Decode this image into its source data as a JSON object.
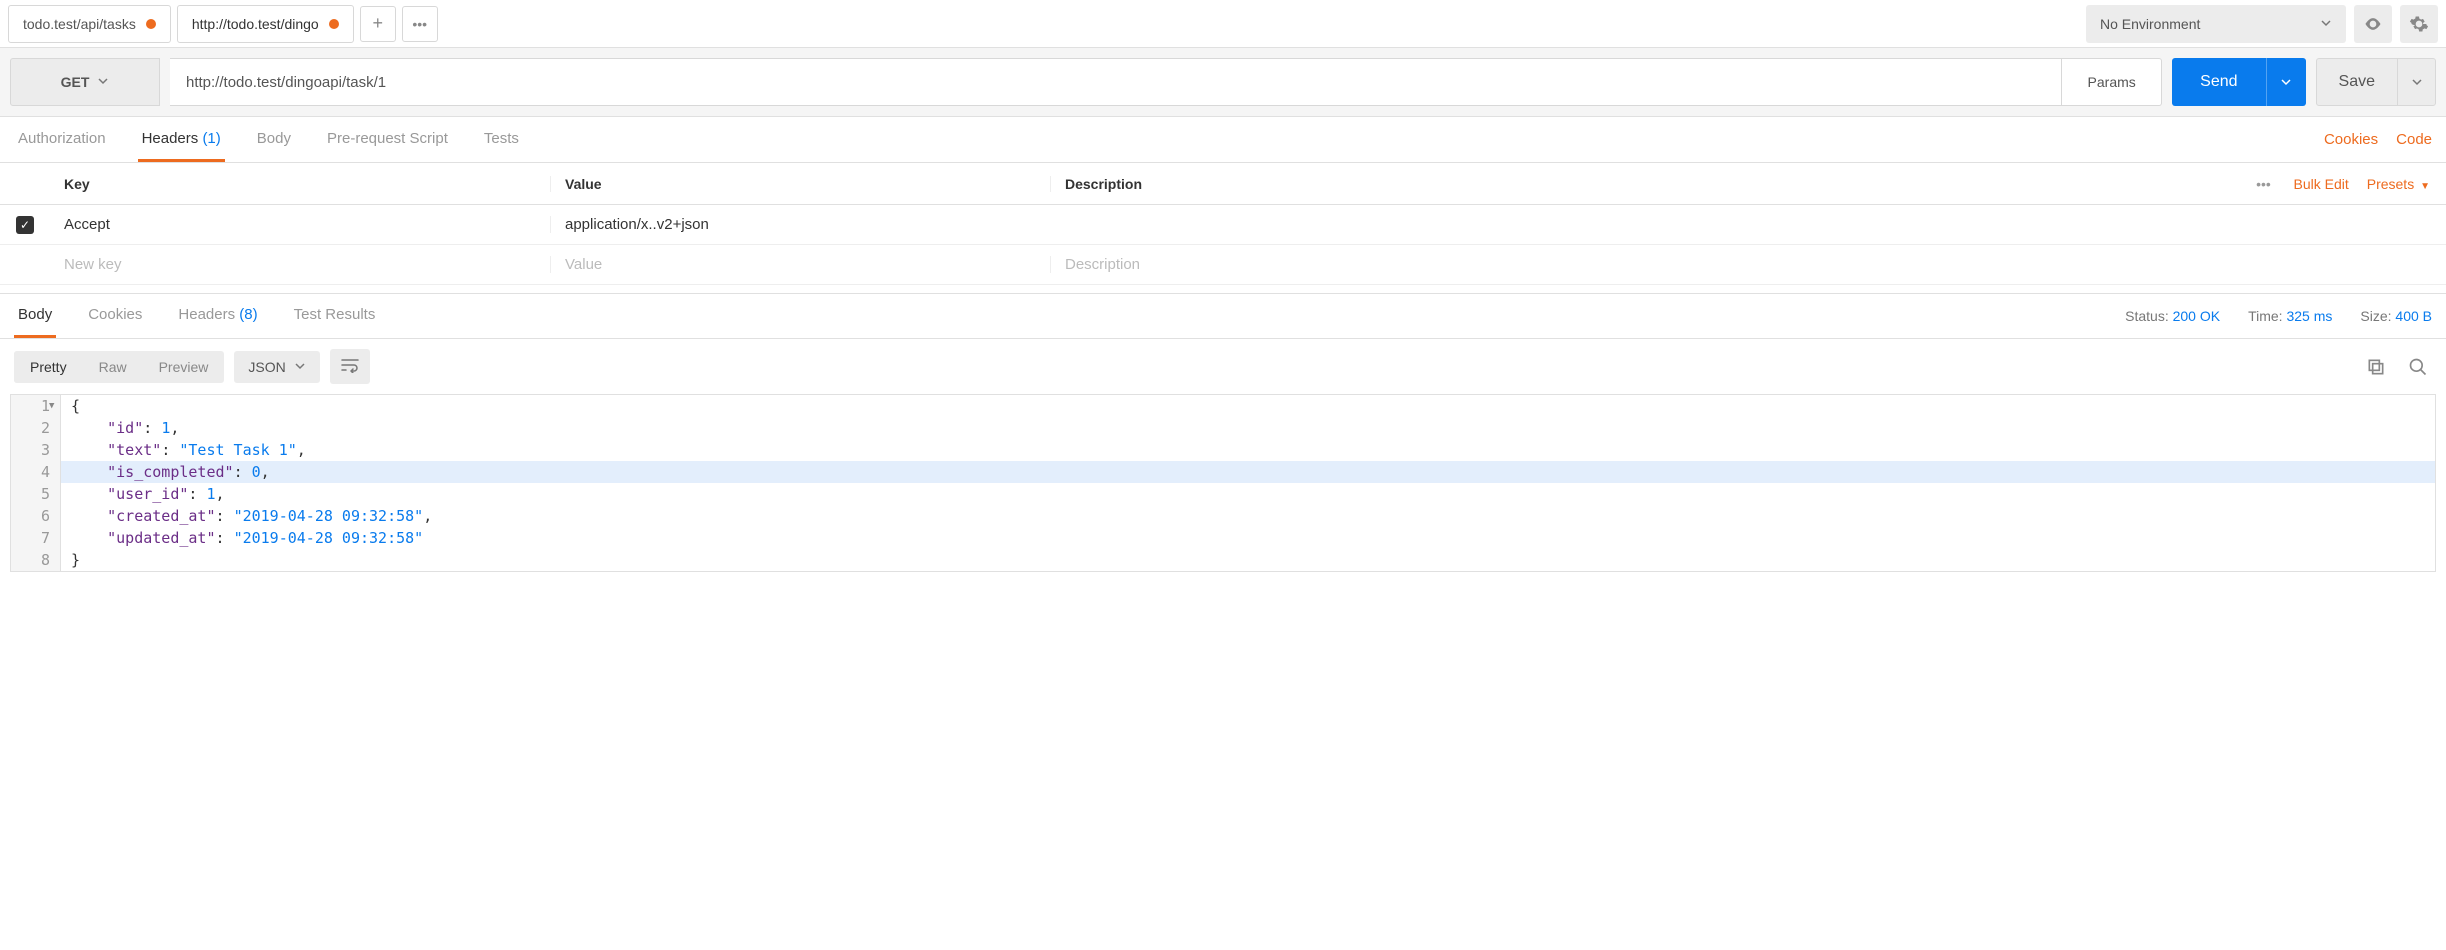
{
  "tabs": [
    {
      "label": "todo.test/api/tasks",
      "dirty": true,
      "active": false
    },
    {
      "label": "http://todo.test/dingo",
      "dirty": true,
      "active": true
    }
  ],
  "environment": {
    "label": "No Environment"
  },
  "request": {
    "method": "GET",
    "url": "http://todo.test/dingoapi/task/1",
    "params_label": "Params",
    "send_label": "Send",
    "save_label": "Save"
  },
  "req_tabs": {
    "authorization": "Authorization",
    "headers": "Headers",
    "headers_count": "(1)",
    "body": "Body",
    "prerequest": "Pre-request Script",
    "tests": "Tests",
    "cookies_link": "Cookies",
    "code_link": "Code"
  },
  "headers_table": {
    "col_key": "Key",
    "col_value": "Value",
    "col_desc": "Description",
    "bulk_edit": "Bulk Edit",
    "presets": "Presets",
    "rows": [
      {
        "checked": true,
        "key": "Accept",
        "value": "application/x..v2+json",
        "desc": ""
      }
    ],
    "new_key_placeholder": "New key",
    "new_value_placeholder": "Value",
    "new_desc_placeholder": "Description"
  },
  "resp_tabs": {
    "body": "Body",
    "cookies": "Cookies",
    "headers": "Headers",
    "headers_count": "(8)",
    "test_results": "Test Results"
  },
  "resp_meta": {
    "status_label": "Status:",
    "status_value": "200 OK",
    "time_label": "Time:",
    "time_value": "325 ms",
    "size_label": "Size:",
    "size_value": "400 B"
  },
  "body_toolbar": {
    "pretty": "Pretty",
    "raw": "Raw",
    "preview": "Preview",
    "format": "JSON"
  },
  "response_json": {
    "id": 1,
    "text": "Test Task 1",
    "is_completed": 0,
    "user_id": 1,
    "created_at": "2019-04-28 09:32:58",
    "updated_at": "2019-04-28 09:32:58"
  },
  "code_lines": {
    "l1": "{",
    "l2_key": "\"id\"",
    "l2_val": "1",
    "l3_key": "\"text\"",
    "l3_val": "\"Test Task 1\"",
    "l4_key": "\"is_completed\"",
    "l4_val": "0",
    "l5_key": "\"user_id\"",
    "l5_val": "1",
    "l6_key": "\"created_at\"",
    "l6_val": "\"2019-04-28 09:32:58\"",
    "l7_key": "\"updated_at\"",
    "l7_val": "\"2019-04-28 09:32:58\"",
    "l8": "}"
  }
}
